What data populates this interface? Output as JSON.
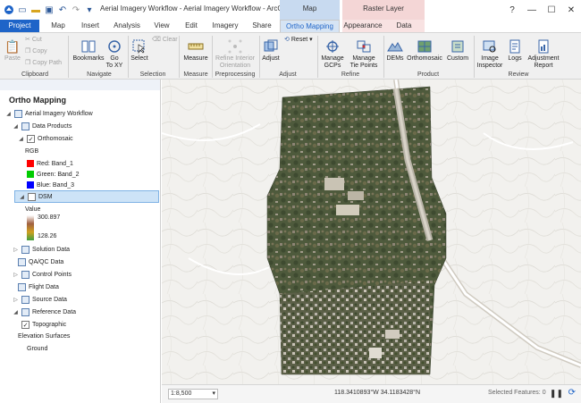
{
  "window": {
    "title": "Aerial Imagery Workflow - Aerial Imagery Workflow - ArcGIS Pro",
    "controls": [
      "?",
      "—",
      "☐",
      "✕"
    ]
  },
  "context_tabs": {
    "map": "Map",
    "raster": "Raster Layer"
  },
  "tabs": [
    "Project",
    "Map",
    "Insert",
    "Analysis",
    "View",
    "Edit",
    "Imagery",
    "Share",
    "Ortho Mapping",
    "Appearance",
    "Data"
  ],
  "ribbon": {
    "clipboard": {
      "paste": "Paste",
      "cut": "Cut",
      "copy": "Copy",
      "copy_path": "Copy Path",
      "label": "Clipboard"
    },
    "navigate": {
      "bookmarks": "Bookmarks",
      "goto": "Go",
      "goto2": "To XY",
      "label": "Navigate"
    },
    "selection": {
      "select": "Select",
      "clear": "Clear",
      "label": "Selection"
    },
    "measure": {
      "measure": "Measure",
      "label": "Measure"
    },
    "preprocessing": {
      "refine": "Refine Interior",
      "refine2": "Orientation",
      "label": "Preprocessing"
    },
    "adjust": {
      "adjust": "Adjust",
      "reset": "Reset",
      "label": "Adjust"
    },
    "refine": {
      "manage_gcps": "Manage",
      "manage_gcps2": "GCPs",
      "manage_tie": "Manage",
      "manage_tie2": "Tie Points",
      "label": "Refine"
    },
    "product": {
      "dems": "DEMs",
      "ortho": "Orthomosaic",
      "custom": "Custom",
      "label": "Product"
    },
    "review": {
      "inspector": "Image",
      "inspector2": "Inspector",
      "logs": "Logs",
      "report": "Adjustment",
      "report2": "Report",
      "label": "Review"
    }
  },
  "pane": {
    "title": "Ortho Mapping",
    "tree": {
      "root": "Aerial Imagery Workflow",
      "data_products": "Data Products",
      "orthomosaic": "Orthomosaic",
      "rgb": "RGB",
      "red": "Red:   Band_1",
      "green": "Green: Band_2",
      "blue": "Blue:  Band_3",
      "dsm": "DSM",
      "value": "Value",
      "max": "300.897",
      "min": "128.26",
      "solution_data": "Solution Data",
      "qaqc": "QA/QC Data",
      "control_points": "Control Points",
      "flight_data": "Flight Data",
      "source_data": "Source Data",
      "reference_data": "Reference Data",
      "topographic": "Topographic",
      "elevation_surfaces": "Elevation Surfaces",
      "ground": "Ground"
    }
  },
  "status": {
    "scale": "1:8,500",
    "coords": "118.3410893°W 34.1183428°N",
    "selected": "Selected Features: 0"
  },
  "colors": {
    "project_tab": "#1e64c8",
    "accent": "#1e64c8",
    "red_swatch": "#ff0000",
    "green_swatch": "#00cc00",
    "blue_swatch": "#0000ff"
  }
}
